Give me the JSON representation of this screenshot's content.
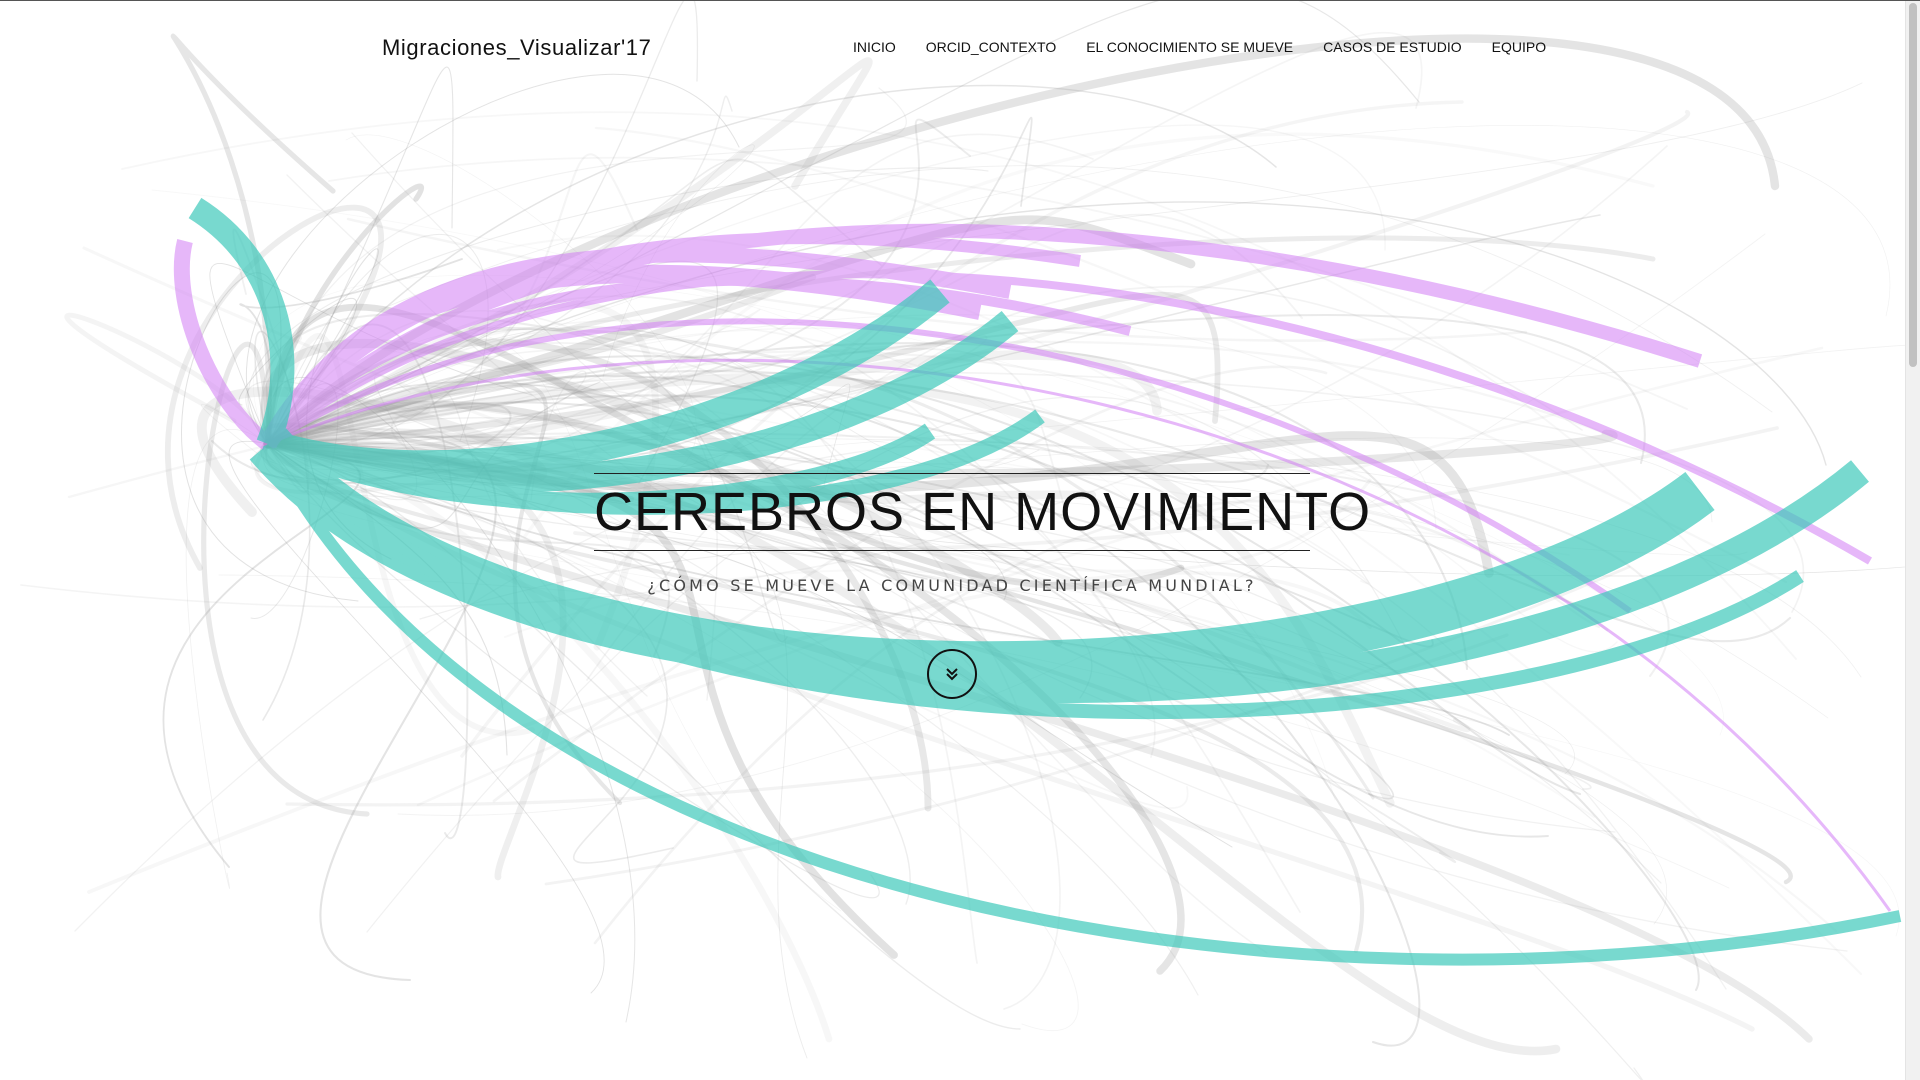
{
  "site": {
    "brand": "Migraciones_Visualizar'17"
  },
  "nav": {
    "items": [
      {
        "label": "INICIO"
      },
      {
        "label": "ORCID_CONTEXTO"
      },
      {
        "label": "EL CONOCIMIENTO SE MUEVE"
      },
      {
        "label": "CASOS DE ESTUDIO"
      },
      {
        "label": "EQUIPO"
      }
    ]
  },
  "hero": {
    "title": "CEREBROS EN MOVIMIENTO",
    "subtitle": "¿CÓMO SE MUEVE LA COMUNIDAD CIENTÍFICA MUNDIAL?",
    "scroll_icon": "double-chevron-down-icon"
  },
  "colors": {
    "teal": "#3fc9bb",
    "purple": "#d27ef5",
    "gray": "#9a9a9a",
    "text": "#111111"
  }
}
